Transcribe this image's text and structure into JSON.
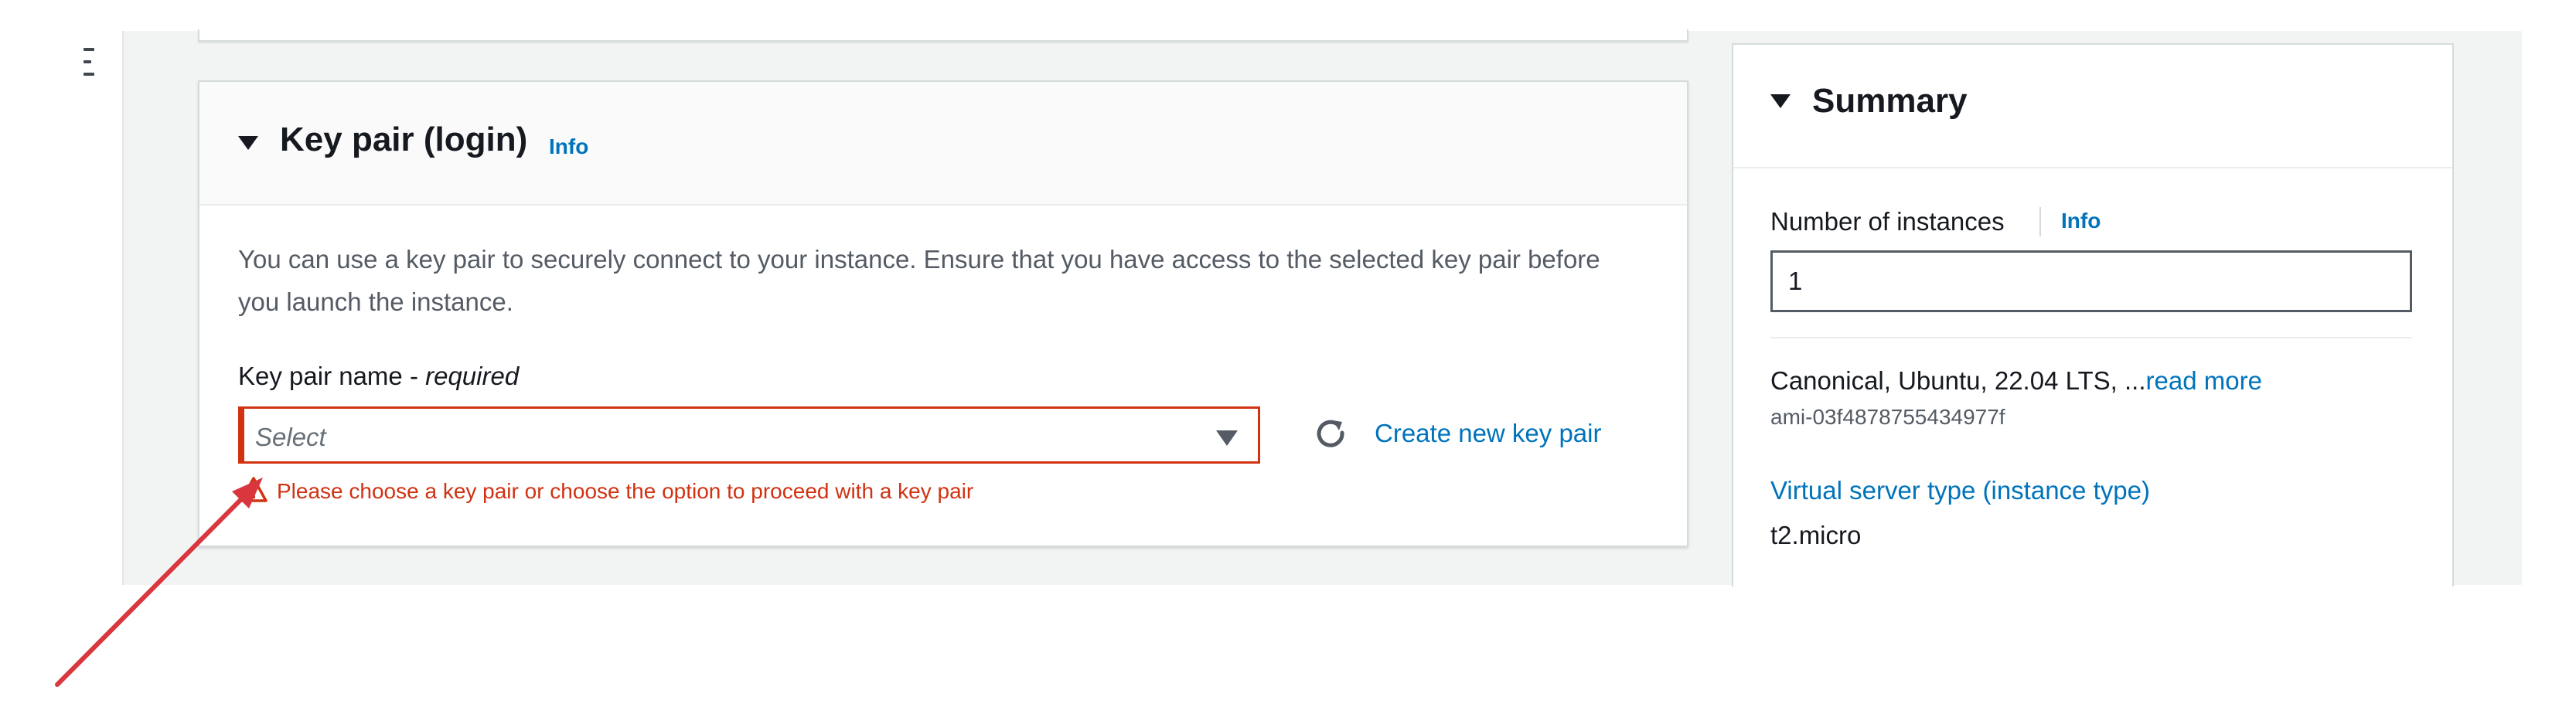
{
  "nav": {
    "menu_icon": "hamburger-menu-icon"
  },
  "key_pair_panel": {
    "title": "Key pair (login)",
    "info_label": "Info",
    "description": "You can use a key pair to securely connect to your instance. Ensure that you have access to the selected key pair before you launch the instance.",
    "field_label": "Key pair name - ",
    "field_required": "required",
    "select_placeholder": "Select",
    "refresh_icon": "refresh-icon",
    "create_link": "Create new key pair",
    "error_message": "Please choose a key pair or choose the option to proceed with a key pair",
    "error_color": "#d13212"
  },
  "summary_panel": {
    "title": "Summary",
    "instances_label": "Number of instances",
    "info_label": "Info",
    "instances_value": "1",
    "ami_description": "Canonical, Ubuntu, 22.04 LTS, ...",
    "ami_read_more": "read more",
    "ami_id": "ami-03f4878755434977f",
    "instance_type_label": "Virtual server type (instance type)",
    "instance_type_value": "t2.micro"
  },
  "annotation": {
    "arrow_color": "#d9363e"
  },
  "colors": {
    "link": "#0073bb",
    "text": "#16191f",
    "muted": "#545b64"
  }
}
